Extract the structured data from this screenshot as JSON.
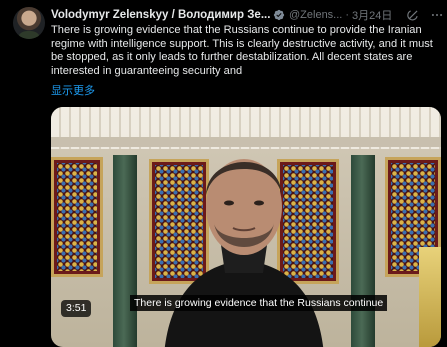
{
  "tweet": {
    "display_name": "Volodymyr Zelenskyy / Володимир Зе...",
    "handle": "@Zelens...",
    "separator": "·",
    "date": "3月24日",
    "text": "There is growing evidence that the Russians continue to provide the Iranian regime with intelligence support. This is clearly destructive activity, and it must be stopped, as it only leads to further destabilization. All decent states are interested in guaranteeing security and",
    "show_more": "显示更多"
  },
  "media": {
    "duration": "3:51",
    "caption": "There is growing evidence that the Russians continue"
  },
  "colors": {
    "background": "#000000",
    "text": "#e7e9ea",
    "secondary": "#71767b",
    "link": "#1d9bf0",
    "verified": "#7e8a96"
  },
  "icons": {
    "verified": "verified-badge-icon",
    "grok": "grok-icon",
    "more": "more-options-icon"
  }
}
